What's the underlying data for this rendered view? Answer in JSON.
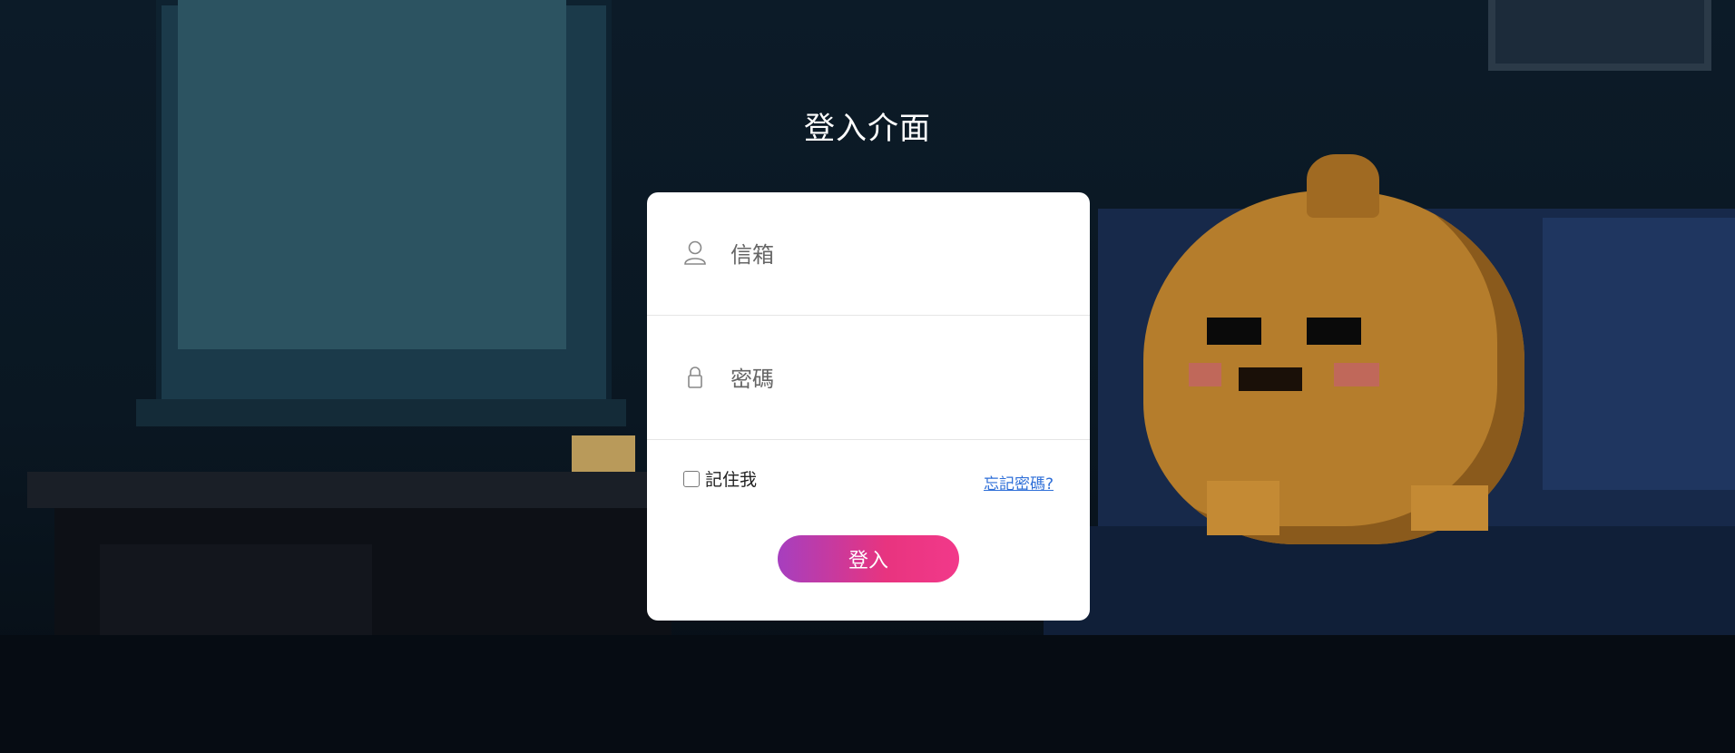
{
  "page": {
    "title": "登入介面"
  },
  "form": {
    "email": {
      "placeholder": "信箱",
      "value": "",
      "icon": "user-icon"
    },
    "password": {
      "placeholder": "密碼",
      "value": "",
      "icon": "lock-icon"
    },
    "remember_label": "記住我",
    "remember_checked": false,
    "forgot_label": "忘記密碼?",
    "submit_label": "登入"
  },
  "colors": {
    "card_bg": "#ffffff",
    "button_gradient_start": "#a63fbf",
    "button_gradient_end": "#f2398a",
    "link": "#2f6fd8",
    "background": "#0b1a26"
  }
}
